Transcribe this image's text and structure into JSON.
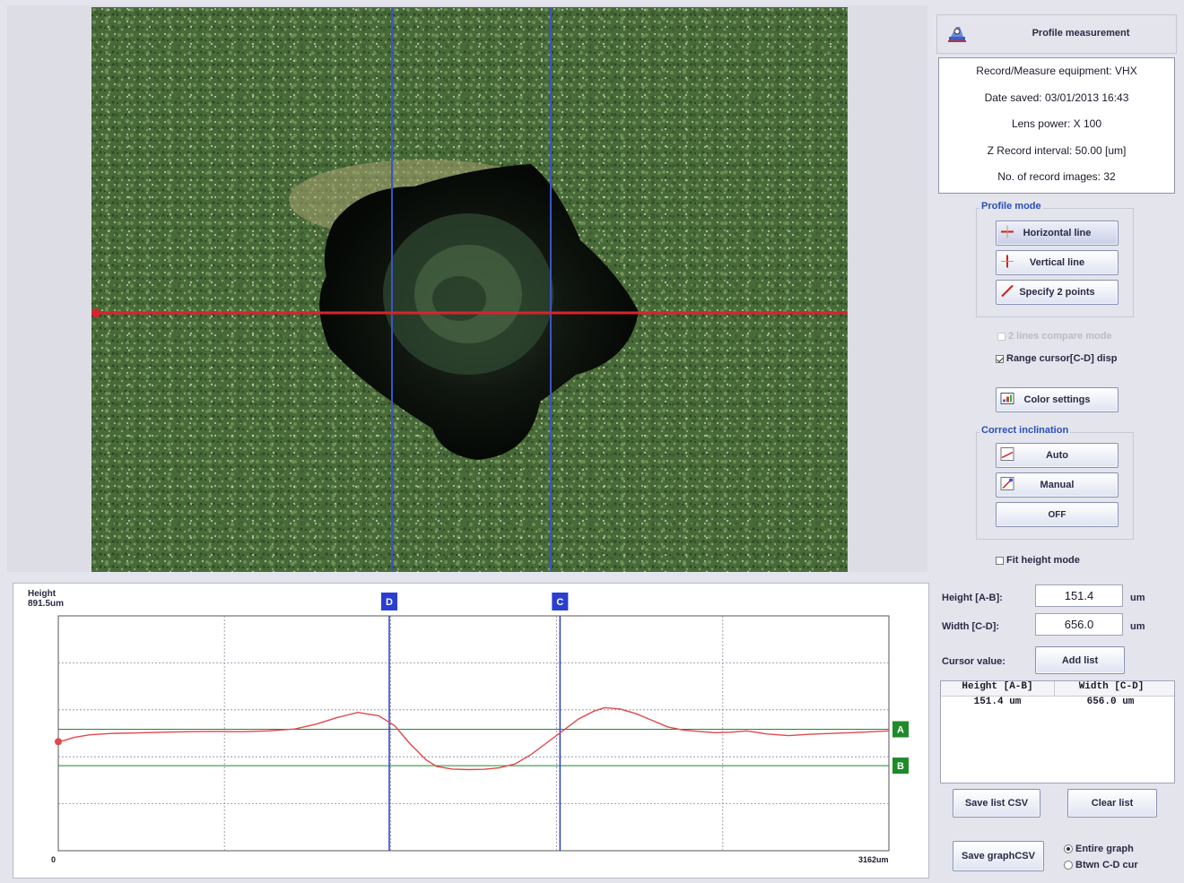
{
  "window": {
    "title": "Profile measurement"
  },
  "info": {
    "lines": [
      "Record/Measure equipment: VHX",
      "Date saved: 03/01/2013 16:43",
      "Lens power: X 100",
      "Z Record interval: 50.00 [um]",
      "No. of record images: 32"
    ]
  },
  "profile_mode": {
    "title": "Profile mode",
    "buttons": [
      "Horizontal line",
      "Vertical line",
      "Specify 2 points"
    ]
  },
  "options": {
    "compare_mode": "2 lines compare mode",
    "range_cursor": "Range cursor[C-D] disp",
    "color_settings": "Color settings"
  },
  "inclination": {
    "title": "Correct inclination",
    "buttons": [
      "Auto",
      "Manual",
      "OFF"
    ]
  },
  "fit_height": "Fit height mode",
  "graph": {
    "y_label_top": "Height",
    "y_label_value": "891.5um",
    "x_min": "0",
    "x_max": "3162um",
    "cursor_d": "D",
    "cursor_c": "C",
    "cursor_a": "A",
    "cursor_b": "B"
  },
  "chart_data": {
    "type": "line",
    "title": "",
    "xlabel": "",
    "ylabel": "Height",
    "xlim": [
      0,
      3162
    ],
    "ylim": [
      0,
      891.5
    ],
    "series": [
      {
        "x": [
          0,
          20,
          60,
          120,
          200,
          300,
          400,
          500,
          600,
          700,
          800,
          900,
          980,
          1060,
          1140,
          1220,
          1280,
          1340,
          1400,
          1440,
          1500,
          1560,
          1620,
          1680,
          1740,
          1800,
          1860,
          1920,
          1980,
          2040,
          2080,
          2140,
          2200,
          2260,
          2320,
          2380,
          2440,
          2500,
          2560,
          2620,
          2700,
          2780,
          2860,
          2940,
          3020,
          3100,
          3162
        ],
        "y": [
          414,
          418,
          430,
          440,
          445,
          447,
          450,
          452,
          453,
          452,
          455,
          462,
          480,
          505,
          525,
          512,
          475,
          405,
          345,
          320,
          310,
          308,
          309,
          315,
          330,
          365,
          410,
          455,
          500,
          530,
          543,
          538,
          520,
          495,
          470,
          458,
          453,
          448,
          450,
          455,
          443,
          437,
          442,
          445,
          448,
          452,
          455
        ]
      }
    ],
    "cursors": {
      "A": 461,
      "B": 323,
      "D": 1260,
      "C": 1910
    },
    "grid": true
  },
  "measure": {
    "height_label": "Height [A-B]:",
    "height_value": "151.4",
    "width_label": "Width [C-D]:",
    "width_value": "656.0",
    "unit": "um",
    "cursor_label": "Cursor value:",
    "add_list": "Add list"
  },
  "list": {
    "headers": [
      "Height [A-B]",
      "Width [C-D]"
    ],
    "rows": [
      [
        "151.4 um",
        "656.0 um"
      ]
    ]
  },
  "actions": {
    "save_list_csv": "Save list CSV",
    "clear_list": "Clear list",
    "save_graph_csv": "Save graphCSV",
    "radio_entire": "Entire graph",
    "radio_between": "Btwn C-D cur"
  },
  "colors": {
    "profile_line": "#e0484c",
    "h_line": "#d8242c",
    "cursor_blue": "#2a3ed0",
    "cursor_green": "#1e8a2a",
    "accent_title": "#2a4fb8"
  }
}
